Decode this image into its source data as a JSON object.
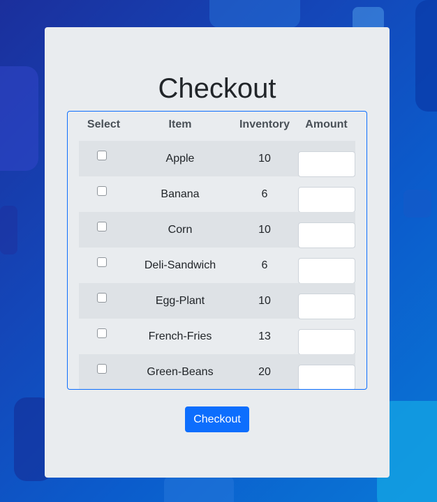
{
  "colors": {
    "accent": "#0d6efd",
    "card_bg": "#e9ecef",
    "stripe": "#dee2e6",
    "heading": "#212529",
    "header_text": "#495057"
  },
  "page": {
    "title": "Checkout"
  },
  "table": {
    "headers": {
      "select": "Select",
      "item": "Item",
      "inventory": "Inventory",
      "amount": "Amount"
    },
    "rows": [
      {
        "item": "Apple",
        "inventory": "10",
        "amount": "",
        "checked": false
      },
      {
        "item": "Banana",
        "inventory": "6",
        "amount": "",
        "checked": false
      },
      {
        "item": "Corn",
        "inventory": "10",
        "amount": "",
        "checked": false
      },
      {
        "item": "Deli-Sandwich",
        "inventory": "6",
        "amount": "",
        "checked": false
      },
      {
        "item": "Egg-Plant",
        "inventory": "10",
        "amount": "",
        "checked": false
      },
      {
        "item": "French-Fries",
        "inventory": "13",
        "amount": "",
        "checked": false
      },
      {
        "item": "Green-Beans",
        "inventory": "20",
        "amount": "",
        "checked": false
      }
    ]
  },
  "buttons": {
    "checkout_label": "Checkout"
  }
}
